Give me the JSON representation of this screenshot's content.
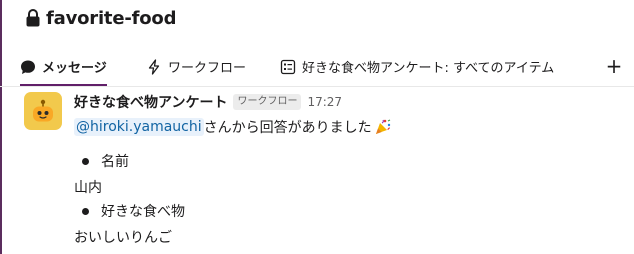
{
  "header": {
    "channel_name": "favorite-food",
    "icon": "lock-icon"
  },
  "tabs": [
    {
      "label": "メッセージ",
      "icon": "message-bubble-icon",
      "active": true
    },
    {
      "label": "ワークフロー",
      "icon": "bolt-icon",
      "active": false
    },
    {
      "label": "好きな食べ物アンケート: すべてのアイテム",
      "icon": "list-icon",
      "active": false
    }
  ],
  "add_tab": {
    "label": "+"
  },
  "message": {
    "sender": "好きな食べ物アンケート",
    "badge": "ワークフロー",
    "time": "17:27",
    "mention": "@hiroki.yamauchi",
    "text": "さんから回答がありました",
    "emoji": "party-popper-icon",
    "fields": [
      {
        "label": "名前",
        "value": "山内"
      },
      {
        "label": "好きな食べ物",
        "value": "おいしいりんご"
      }
    ]
  },
  "colors": {
    "accent": "#611f69",
    "mention_bg": "#e8f1fb",
    "mention_text": "#1264a3",
    "avatar_bg": "#f2c94c"
  }
}
